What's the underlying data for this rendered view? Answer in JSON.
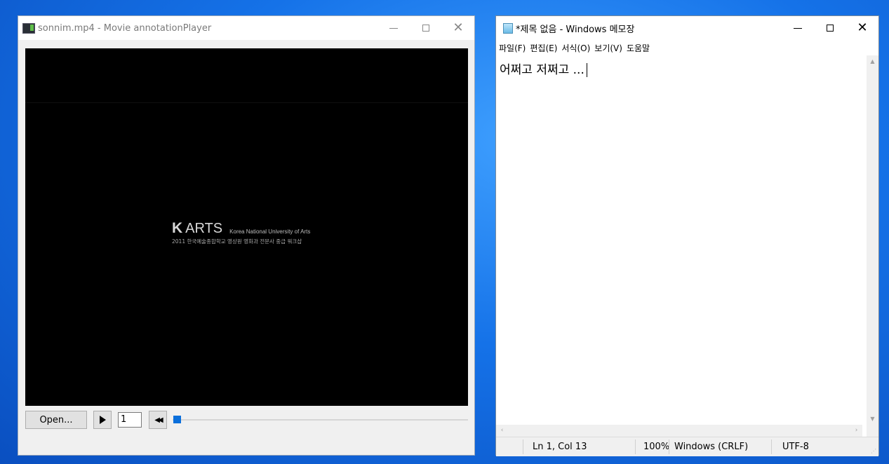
{
  "player": {
    "title": "sonnim.mp4 - Movie annotationPlayer",
    "video": {
      "logo_mark": "K",
      "logo_word": "ARTS",
      "university": "Korea National University of Arts",
      "subtitle": "2011 한국예술종합학교 영상원 영화과 전문사 중급 워크샵"
    },
    "controls": {
      "open_label": "Open...",
      "frame_value": "1",
      "play_icon": "play-icon",
      "rewind_icon": "rewind-icon",
      "slider_fraction": 0.0
    }
  },
  "notepad": {
    "title": "*제목 없음 - Windows 메모장",
    "menu": [
      "파일(F)",
      "편집(E)",
      "서식(O)",
      "보기(V)",
      "도움말"
    ],
    "content": "어쩌고 저쩌고 ...",
    "status": {
      "position": "Ln 1, Col 13",
      "zoom": "100%",
      "line_ending": "Windows (CRLF)",
      "encoding": "UTF-8"
    }
  },
  "colors": {
    "accent": "#0b6fdb",
    "desktop": "#1572e8"
  }
}
